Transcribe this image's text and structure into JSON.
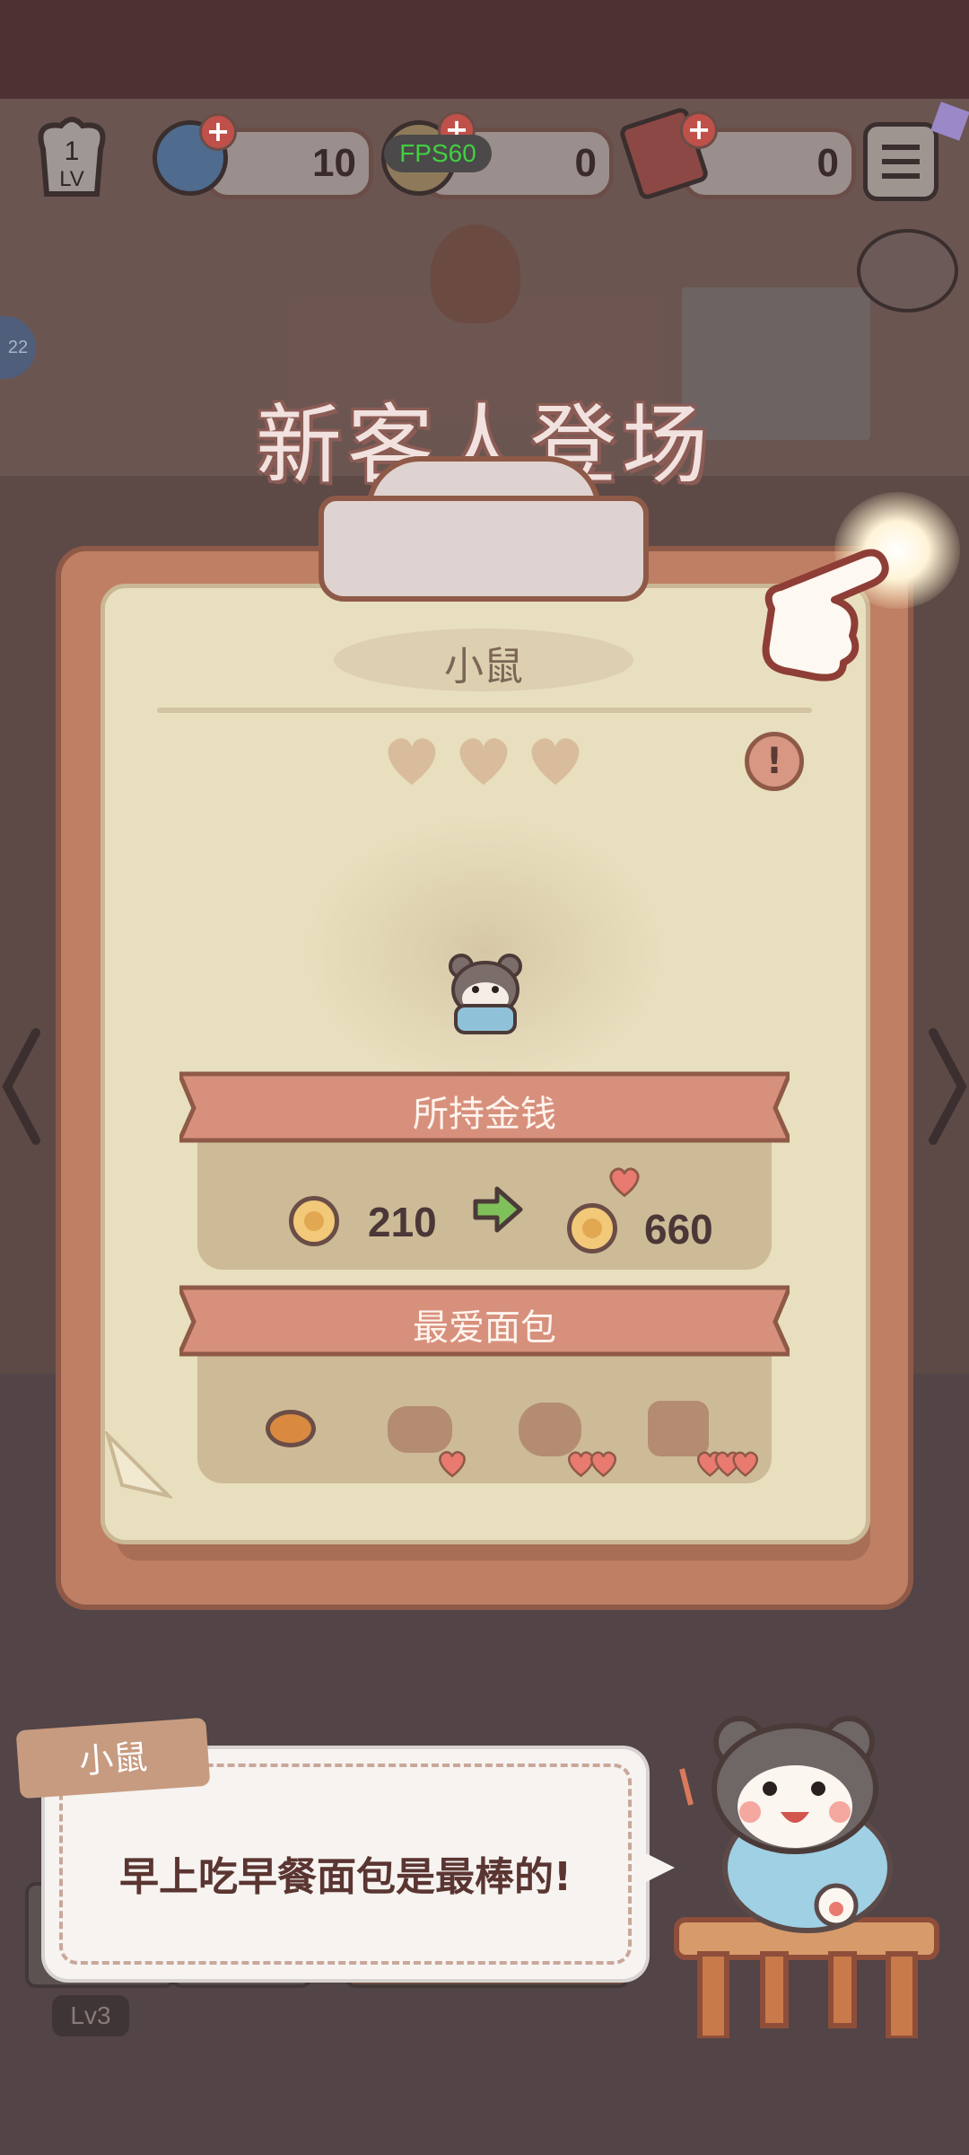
{
  "hud": {
    "level": "1",
    "level_tag": "LV",
    "gems": "10",
    "fps": "FPS60",
    "coins": "0",
    "tickets": "0",
    "plus": "+",
    "side_badge": "22"
  },
  "title": "新客人登场",
  "card": {
    "customer_name": "小鼠",
    "hearts_total": 3,
    "info_symbol": "!",
    "money_section": {
      "label": "所持金钱",
      "from": "210",
      "to": "660"
    },
    "bread_section": {
      "label": "最爱面包",
      "slots": [
        {
          "unlocked": true,
          "hearts": 0
        },
        {
          "unlocked": false,
          "hearts": 1
        },
        {
          "unlocked": false,
          "hearts": 2
        },
        {
          "unlocked": false,
          "hearts": 3
        }
      ]
    }
  },
  "dialog": {
    "speaker": "小鼠",
    "text": "早上吃早餐面包是最棒的!"
  },
  "bottom": {
    "level_label": "Lv3"
  },
  "colors": {
    "accent": "#bf7f64",
    "banner": "#d7907c",
    "heart_empty": "#d9bc9b",
    "heart_red": "#e87a6f"
  }
}
